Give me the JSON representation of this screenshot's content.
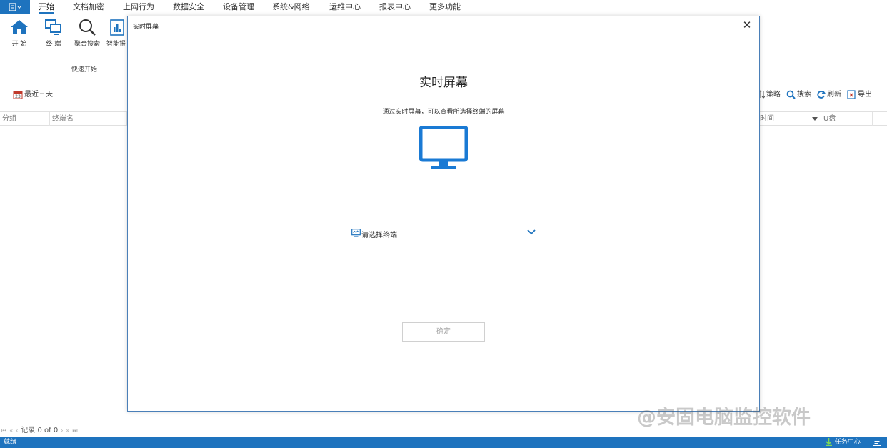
{
  "menubar": {
    "app_menu_icon": "menu-icon",
    "tabs": [
      {
        "label": "开始",
        "active": true
      },
      {
        "label": "文档加密"
      },
      {
        "label": "上网行为"
      },
      {
        "label": "数据安全"
      },
      {
        "label": "设备管理"
      },
      {
        "label": "系统&网络"
      },
      {
        "label": "运维中心"
      },
      {
        "label": "报表中心"
      },
      {
        "label": "更多功能"
      }
    ]
  },
  "ribbon": {
    "buttons": [
      {
        "label": "开 始",
        "icon": "home-icon"
      },
      {
        "label": "终 端",
        "icon": "terminal-icon"
      },
      {
        "label": "聚合搜索",
        "icon": "search-icon"
      },
      {
        "label": "智能报",
        "icon": "report-icon"
      }
    ],
    "group_label": "快速开始"
  },
  "toolbar": {
    "date_filter": "最近三天",
    "policy": "策略",
    "search": "搜索",
    "refresh": "刷新",
    "export": "导出"
  },
  "columns": {
    "group": "分组",
    "terminal_name": "终端名",
    "time": "时间",
    "usb": "U盘"
  },
  "pager": {
    "record_text": "记录 0 of 0"
  },
  "statusbar": {
    "status": "就绪",
    "task_center": "任务中心"
  },
  "dialog": {
    "title": "实时屏幕",
    "close_symbol": "✕",
    "heading": "实时屏幕",
    "description": "通过实时屏幕，可以查看所选择终端的屏幕",
    "select_placeholder": "请选择终端",
    "confirm_label": "确定"
  },
  "watermark": "@安固电脑监控软件",
  "colors": {
    "accent": "#1e73be",
    "monitor": "#1a7ad4"
  }
}
